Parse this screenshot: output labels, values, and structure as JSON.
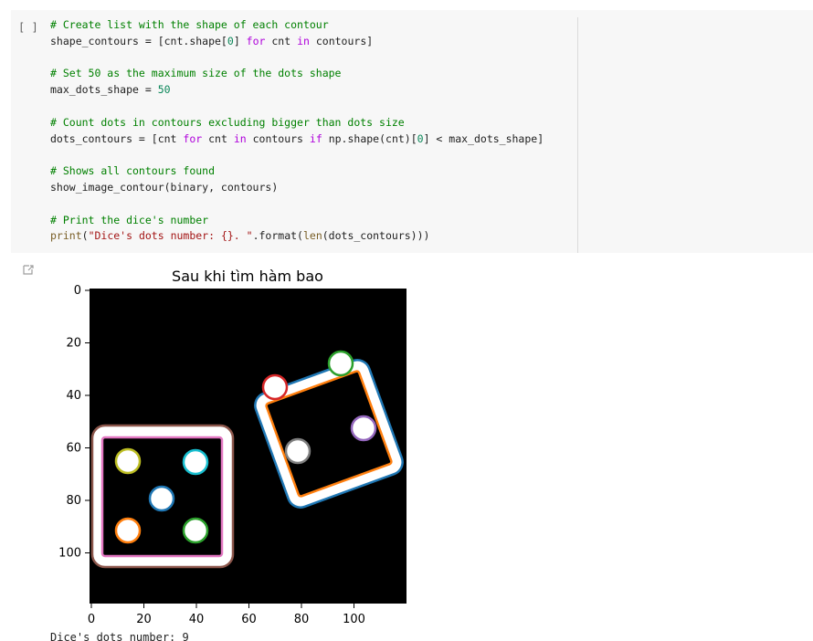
{
  "cell": {
    "run_label": "[ ]",
    "code_lines": [
      [
        {
          "t": "# Create list with the shape of each contour",
          "c": "cm"
        }
      ],
      [
        {
          "t": "shape_contours = [cnt.shape["
        },
        {
          "t": "0",
          "c": "num"
        },
        {
          "t": "] "
        },
        {
          "t": "for",
          "c": "kw"
        },
        {
          "t": " cnt "
        },
        {
          "t": "in",
          "c": "kw"
        },
        {
          "t": " contours]"
        }
      ],
      [],
      [
        {
          "t": "# Set 50 as the maximum size of the dots shape",
          "c": "cm"
        }
      ],
      [
        {
          "t": "max_dots_shape = "
        },
        {
          "t": "50",
          "c": "num"
        }
      ],
      [],
      [
        {
          "t": "# Count dots in contours excluding bigger than dots size",
          "c": "cm"
        }
      ],
      [
        {
          "t": "dots_contours = [cnt "
        },
        {
          "t": "for",
          "c": "kw"
        },
        {
          "t": " cnt "
        },
        {
          "t": "in",
          "c": "kw"
        },
        {
          "t": " contours "
        },
        {
          "t": "if",
          "c": "kw"
        },
        {
          "t": " np.shape(cnt)["
        },
        {
          "t": "0",
          "c": "num"
        },
        {
          "t": "] < max_dots_shape]"
        }
      ],
      [],
      [
        {
          "t": "# Shows all contours found",
          "c": "cm"
        }
      ],
      [
        {
          "t": "show_image_contour(binary, contours)"
        }
      ],
      [],
      [
        {
          "t": "# Print the dice's number",
          "c": "cm"
        }
      ],
      [
        {
          "t": "print",
          "c": "fn"
        },
        {
          "t": "("
        },
        {
          "t": "\"Dice's dots number: {}. \"",
          "c": "str"
        },
        {
          "t": ".format("
        },
        {
          "t": "len",
          "c": "fn"
        },
        {
          "t": "(dots_contours)))"
        }
      ]
    ]
  },
  "figure": {
    "title": "Sau khi tìm hàm bao",
    "xticks": [
      "0",
      "20",
      "40",
      "60",
      "80",
      "100"
    ],
    "yticks": [
      "0",
      "20",
      "40",
      "60",
      "80",
      "100"
    ],
    "contour_colors": {
      "big_die_outer": "#1f77b4",
      "big_die_inner": "#ff7f0e",
      "small_die_outer": "#8c564b",
      "small_die_inner": "#e377c2",
      "dot_red": "#d62728",
      "dot_green": "#2ca02c",
      "dot_purple": "#9467bd",
      "dot_gray": "#7f7f7f",
      "dot_olive": "#bcbd22",
      "dot_cyan": "#17becf",
      "dot_blue": "#1f77b4",
      "dot_orange": "#ff7f0e"
    }
  },
  "output": {
    "stdout": "Dice's dots number: 9"
  }
}
